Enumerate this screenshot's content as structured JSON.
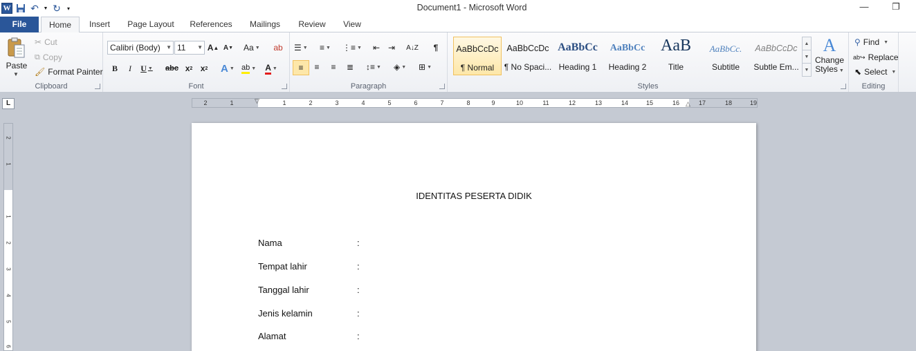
{
  "window": {
    "title": "Document1 - Microsoft Word"
  },
  "tabs": [
    "File",
    "Home",
    "Insert",
    "Page Layout",
    "References",
    "Mailings",
    "Review",
    "View"
  ],
  "active_tab": "Home",
  "clipboard": {
    "paste": "Paste",
    "cut": "Cut",
    "copy": "Copy",
    "format_painter": "Format Painter",
    "label": "Clipboard"
  },
  "font": {
    "name": "Calibri (Body)",
    "size": "11",
    "label": "Font"
  },
  "paragraph": {
    "label": "Paragraph"
  },
  "styles": {
    "label": "Styles",
    "items": [
      {
        "preview": "AaBbCcDc",
        "name": "¶ Normal"
      },
      {
        "preview": "AaBbCcDc",
        "name": "¶ No Spaci..."
      },
      {
        "preview": "AaBbCc",
        "name": "Heading 1"
      },
      {
        "preview": "AaBbCc",
        "name": "Heading 2"
      },
      {
        "preview": "AaB",
        "name": "Title"
      },
      {
        "preview": "AaBbCc.",
        "name": "Subtitle"
      },
      {
        "preview": "AaBbCcDc",
        "name": "Subtle Em..."
      }
    ],
    "change_styles": [
      "Change",
      "Styles"
    ]
  },
  "editing": {
    "find": "Find",
    "replace": "Replace",
    "select": "Select",
    "label": "Editing"
  },
  "ruler": {
    "marks": [
      "2",
      "1",
      "1",
      "2",
      "3",
      "4",
      "5",
      "6",
      "7",
      "8",
      "9",
      "10",
      "11",
      "12",
      "13",
      "14",
      "15",
      "16",
      "17",
      "18",
      "19"
    ]
  },
  "vruler": {
    "marks": [
      "2",
      "1",
      "1",
      "2",
      "3",
      "4",
      "5",
      "6"
    ]
  },
  "document": {
    "title": "IDENTITAS PESERTA DIDIK",
    "fields": [
      {
        "label": "Nama",
        "sep": ":"
      },
      {
        "label": "Tempat lahir",
        "sep": ":"
      },
      {
        "label": "Tanggal lahir",
        "sep": ":"
      },
      {
        "label": "Jenis kelamin",
        "sep": ":"
      },
      {
        "label": "Alamat",
        "sep": ":"
      }
    ]
  }
}
